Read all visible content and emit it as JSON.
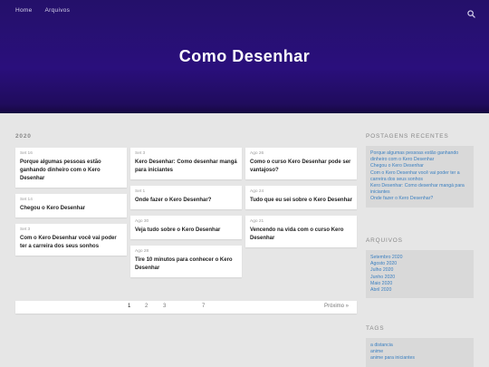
{
  "nav": {
    "home": "Home",
    "archive": "Arquivos"
  },
  "site": {
    "title": "Como Desenhar"
  },
  "main": {
    "year": "2020",
    "columns": [
      [
        {
          "date": "Set 16",
          "title": "Porque algumas pessoas estão ganhando dinheiro com o Kero Desenhar"
        },
        {
          "date": "Set 14",
          "title": "Chegou o Kero Desenhar"
        },
        {
          "date": "Set 3",
          "title": "Com o Kero Desenhar você vai poder ter a carreira dos seus sonhos"
        }
      ],
      [
        {
          "date": "Set 3",
          "title": "Kero Desenhar: Como desenhar mangá para iniciantes"
        },
        {
          "date": "Set 1",
          "title": "Onde fazer o Kero Desenhar?"
        },
        {
          "date": "Ago 30",
          "title": "Veja tudo sobre o Kero Desenhar"
        },
        {
          "date": "Ago 28",
          "title": "Tire 10 minutos para conhecer o Kero Desenhar"
        }
      ],
      [
        {
          "date": "Ago 26",
          "title": "Como o curso Kero Desenhar pode ser vantajoso?"
        },
        {
          "date": "Ago 24",
          "title": "Tudo que eu sei sobre o Kero Desenhar"
        },
        {
          "date": "Ago 21",
          "title": "Vencendo na vida com o curso Kero Desenhar"
        }
      ]
    ]
  },
  "pagination": {
    "pages": [
      "1",
      "2",
      "3",
      "7"
    ],
    "next": "Próximo »"
  },
  "sidebar": {
    "recent": {
      "heading": "POSTAGENS RECENTES",
      "links": [
        "Porque algumas pessoas estão ganhando dinheiro com o Kero Desenhar",
        "Chegou o Kero Desenhar",
        "Com o Kero Desenhar você vai poder ter a carreira dos seus sonhos",
        "Kero Desenhar: Como desenhar mangá para iniciantes",
        "Onde fazer o Kero Desenhar?"
      ]
    },
    "archives": {
      "heading": "ARQUIVOS",
      "links": [
        "Setembro 2020",
        "Agosto 2020",
        "Julho 2020",
        "Junho 2020",
        "Maio 2020",
        "Abril 2020"
      ]
    },
    "tags": {
      "heading": "TAGS",
      "links": [
        "a distancia",
        "anime",
        "anime para iniciantes"
      ]
    }
  },
  "icons": {
    "search": "search-icon"
  },
  "colors": {
    "hero": "#24106a",
    "link": "#3a7fc0",
    "background": "#e6e6e6"
  }
}
